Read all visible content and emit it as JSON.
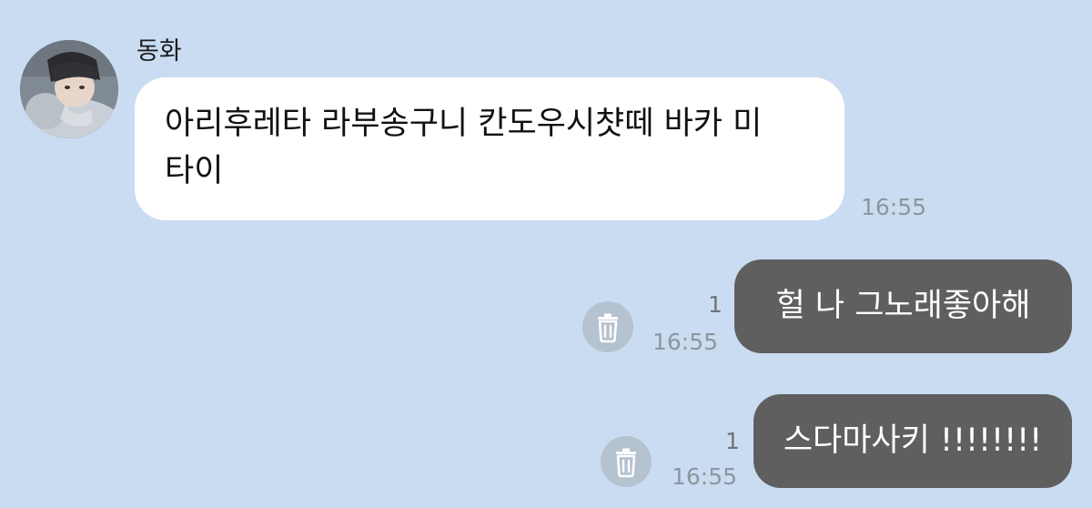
{
  "chat": {
    "sender_name": "동화",
    "avatar_icon": "profile-photo",
    "incoming": {
      "lines": [
        "아리후레타 라부송구니 칸도우시챳떼 바카 미",
        "타이"
      ],
      "time": "16:55"
    },
    "outgoing": [
      {
        "text": "헐 나 그노래좋아해",
        "unread": "1",
        "time": "16:55",
        "action_icon": "trash-icon"
      },
      {
        "text": "스다마사키 !!!!!!!!",
        "unread": "1",
        "time": "16:55",
        "action_icon": "trash-icon"
      }
    ]
  },
  "colors": {
    "background": "#cadcf1",
    "incoming_bubble": "#ffffff",
    "outgoing_bubble": "#5f5f5f",
    "trash_circle": "#b5c2cf"
  }
}
